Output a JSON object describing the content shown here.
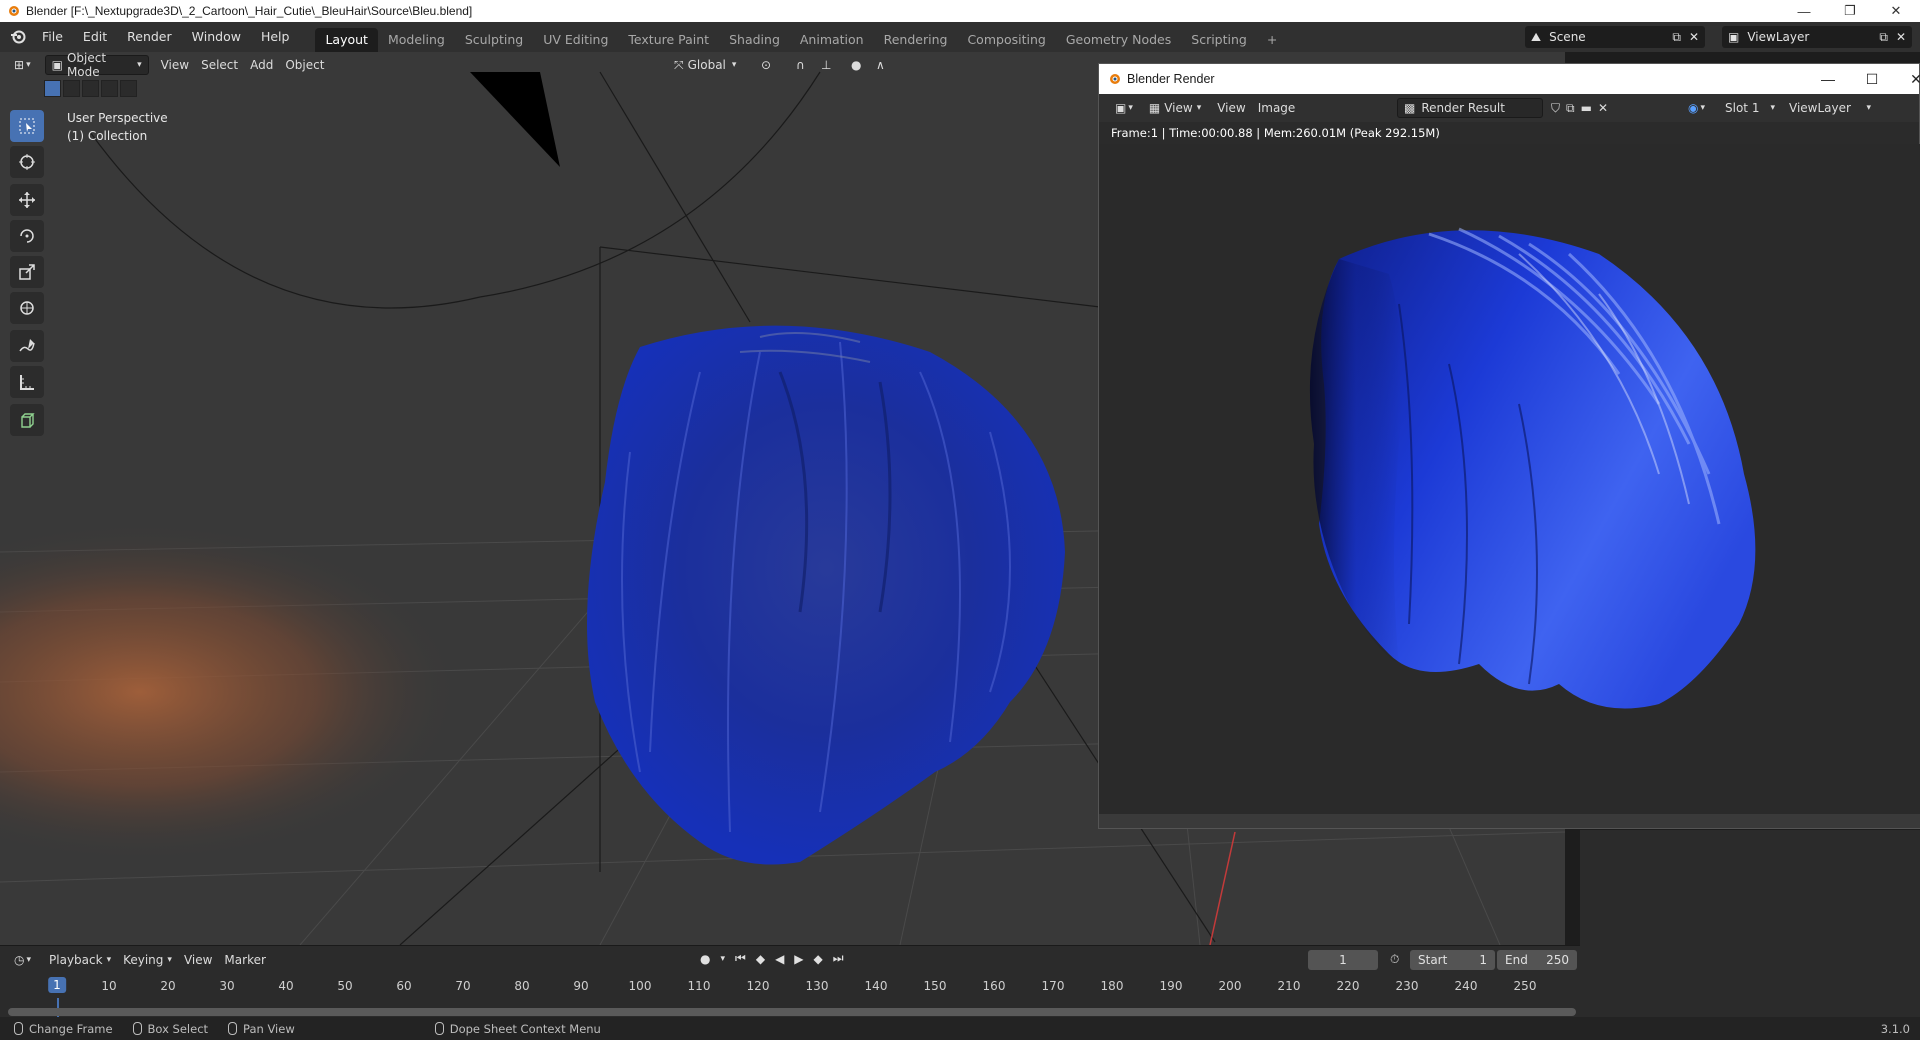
{
  "os_window": {
    "title": "Blender [F:\\_Nextupgrade3D\\_2_Cartoon\\_Hair_Cutie\\_BleuHair\\Source\\Bleu.blend]",
    "controls": [
      "—",
      "❐",
      "✕"
    ]
  },
  "menu": {
    "items": [
      "File",
      "Edit",
      "Render",
      "Window",
      "Help"
    ]
  },
  "workspaces": {
    "active": "Layout",
    "tabs": [
      "Layout",
      "Modeling",
      "Sculpting",
      "UV Editing",
      "Texture Paint",
      "Shading",
      "Animation",
      "Rendering",
      "Compositing",
      "Geometry Nodes",
      "Scripting"
    ],
    "add_label": "+"
  },
  "scene": {
    "name": "Scene",
    "view_layer": "ViewLayer"
  },
  "viewport": {
    "mode": "Object Mode",
    "menus": [
      "View",
      "Select",
      "Add",
      "Object"
    ],
    "transform_orientation": "Global",
    "perspective_label": "User Perspective",
    "collection_label": "(1) Collection",
    "tools": [
      "select-box-icon",
      "cursor-icon",
      "move-icon",
      "rotate-icon",
      "scale-icon",
      "transform-icon",
      "annotate-icon",
      "measure-icon",
      "add-cube-icon"
    ]
  },
  "render_window": {
    "title": "Blender Render",
    "menus": [
      "View",
      "View",
      "Image"
    ],
    "image_name": "Render Result",
    "slot": "Slot 1",
    "view_layer": "ViewLayer",
    "stats": "Frame:1 | Time:00:00.88 | Mem:260.01M (Peak 292.15M)"
  },
  "timeline": {
    "menus": [
      "Playback",
      "Keying",
      "View",
      "Marker"
    ],
    "current_frame": "1",
    "start_label": "Start",
    "start": "1",
    "end_label": "End",
    "end": "250",
    "ticks": [
      "1",
      "10",
      "20",
      "30",
      "40",
      "50",
      "60",
      "70",
      "80",
      "90",
      "100",
      "110",
      "120",
      "130",
      "140",
      "150",
      "160",
      "170",
      "180",
      "190",
      "200",
      "210",
      "220",
      "230",
      "240",
      "250"
    ]
  },
  "statusbar": {
    "items": [
      "Change Frame",
      "Box Select",
      "Pan View",
      "Dope Sheet Context Menu"
    ],
    "version": "3.1.0"
  },
  "colors": {
    "accent": "#4772b3",
    "hair_blue": "#1d3fd6"
  }
}
